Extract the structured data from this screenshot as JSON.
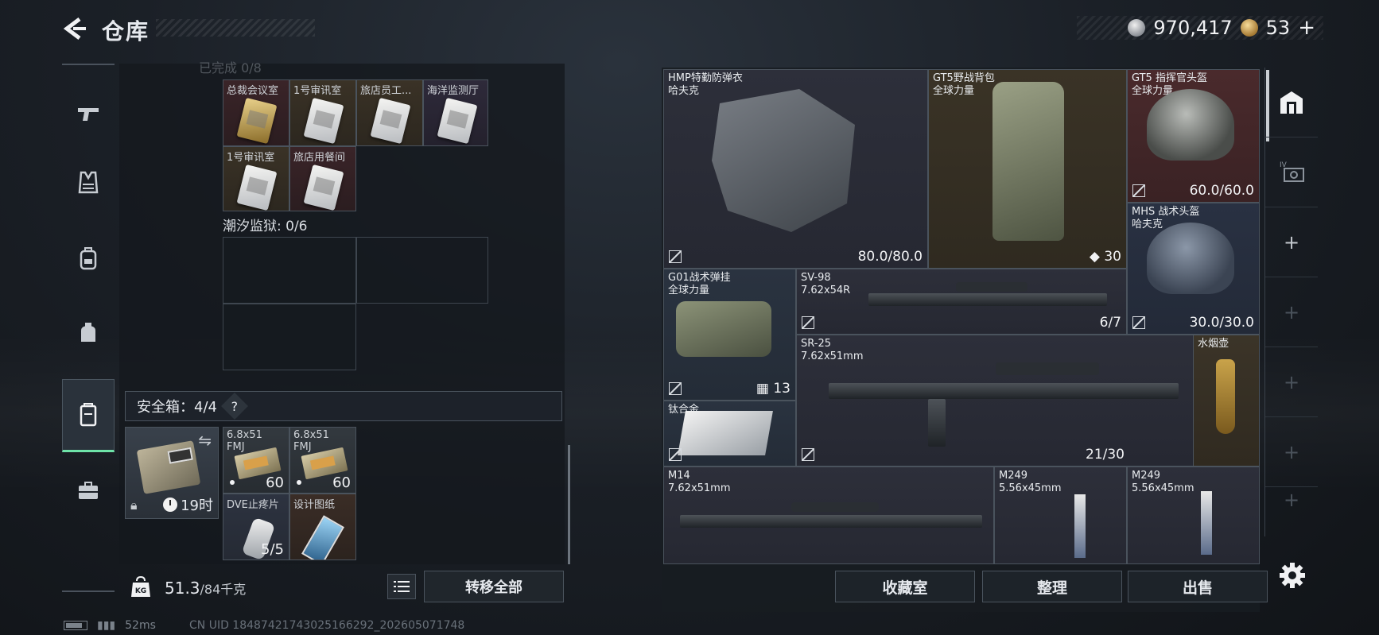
{
  "header": {
    "title": "仓库",
    "silver_amount": "970,417",
    "gold_amount": "53",
    "add_label": "+"
  },
  "left_nav": {
    "items": [
      "weapons-icon",
      "armor-icon",
      "backpack-icon",
      "pouch-icon",
      "safebox-icon",
      "toolbox-icon"
    ],
    "active": "safebox-icon"
  },
  "keycards": {
    "section_cut": "已完成 0/8",
    "slots": [
      {
        "label": "总裁会议室",
        "color": "red"
      },
      {
        "label": "1号审讯室",
        "color": "gold"
      },
      {
        "label": "旅店员工...",
        "color": "gold"
      },
      {
        "label": "海洋监测厅",
        "color": "purple"
      },
      {
        "label": "1号审讯室",
        "color": "gold"
      },
      {
        "label": "旅店用餐间",
        "color": "red"
      }
    ]
  },
  "prison": {
    "label": "潮汐监狱: 0/6"
  },
  "safebox": {
    "label": "安全箱：4/4",
    "help": "?",
    "timer": "19时",
    "items": [
      {
        "label": "6.8x51 FMJ",
        "count": "60"
      },
      {
        "label": "6.8x51 FMJ",
        "count": "60"
      },
      {
        "label": "DVE止疼片",
        "count": "5/5"
      },
      {
        "label": "设计图纸",
        "count": ""
      }
    ]
  },
  "weight": {
    "icon_text": "KG",
    "current": "51.3",
    "capacity": "/84千克",
    "transfer_all": "转移全部"
  },
  "status_bar": {
    "latency": "52ms",
    "uid": "CN UID 18487421743025166292_202605071748"
  },
  "stash_items": [
    {
      "name": "HMP特勤防弹衣",
      "sub": "哈夫克",
      "stat": "80.0/80.0"
    },
    {
      "name": "GT5野战背包",
      "sub": "全球力量",
      "stat": "30"
    },
    {
      "name": "GT5 指挥官头盔",
      "sub": "全球力量",
      "stat": "60.0/60.0"
    },
    {
      "name": "MHS 战术头盔",
      "sub": "哈夫克",
      "stat": "30.0/30.0"
    },
    {
      "name": "G01战术弹挂",
      "sub": "全球力量",
      "stat": "13"
    },
    {
      "name": "SV-98",
      "sub": "7.62x54R",
      "stat": "6/7"
    },
    {
      "name": "SR-25",
      "sub": "7.62x51mm",
      "stat": "21/30"
    },
    {
      "name": "水烟壶",
      "sub": "",
      "stat": ""
    },
    {
      "name": "钛合金",
      "sub": "",
      "stat": ""
    },
    {
      "name": "M14",
      "sub": "7.62x51mm",
      "stat": ""
    },
    {
      "name": "M249",
      "sub": "5.56x45mm",
      "stat": ""
    },
    {
      "name": "M249",
      "sub": "5.56x45mm",
      "stat": ""
    }
  ],
  "right_tabs": {
    "tier_label": "IV"
  },
  "actions": {
    "collection": "收藏室",
    "organize": "整理",
    "sell": "出售"
  }
}
